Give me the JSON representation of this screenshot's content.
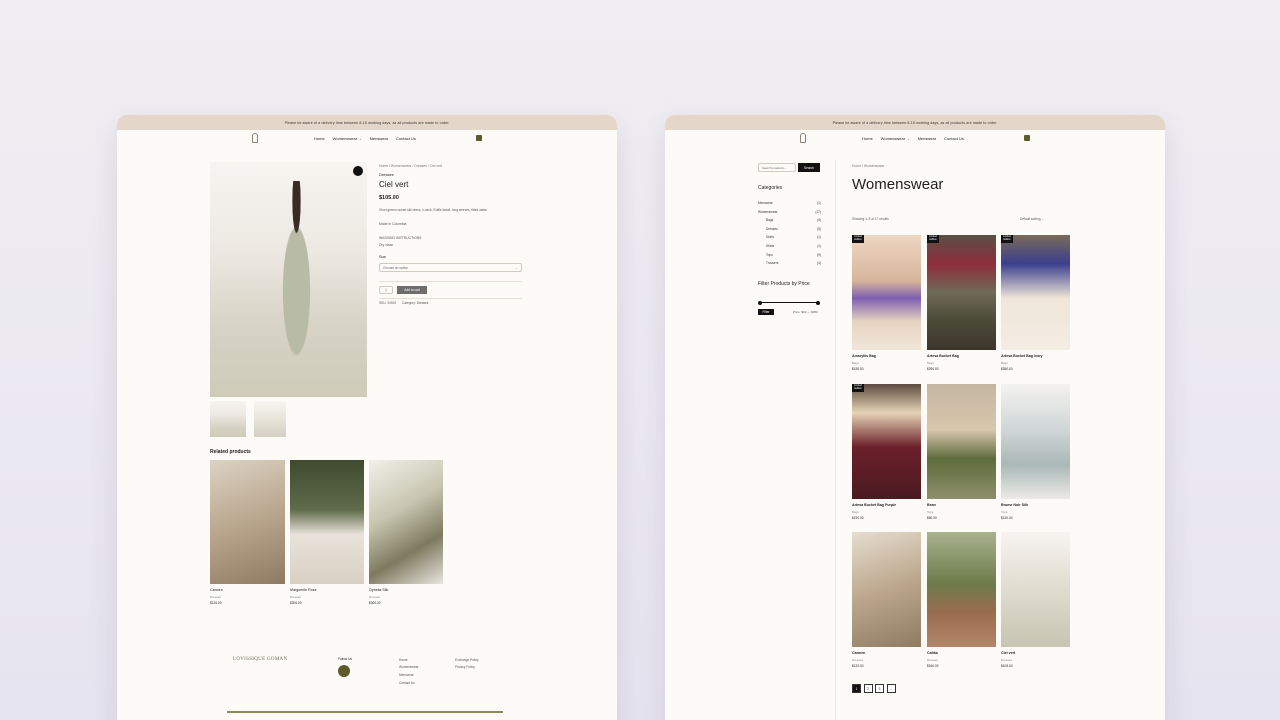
{
  "announcement": "Please be aware of a delivery time between 8-15 working days, as all products are made to order.",
  "nav": {
    "home": "Home",
    "womenswear": "Womenswear",
    "menswear": "Menswear",
    "contact": "Contact Us",
    "chevron": "⌄"
  },
  "product": {
    "breadcrumb": "Home / Womenswear / Dresses / Ciel vert",
    "category": "Dresses",
    "title": "Ciel vert",
    "price": "$105.00",
    "description": "Short green ruched silk dress, v-neck, Ruffle detail, long sleeves, fitted waist.",
    "made_in": "Made in Colombia",
    "washing_title": "WASHING INSTRUCTIONS",
    "washing_text": "Dry clean",
    "size_label": "Size",
    "size_placeholder": "Choose an option",
    "qty": "1",
    "add_to_cart": "Add to cart",
    "sku": "SKU: 20022",
    "category_meta": "Category: Dresses",
    "related_title": "Related products",
    "related": [
      {
        "name": "Carmen",
        "cat": "Dresses",
        "price": "$120.00"
      },
      {
        "name": "Marguerite Rose",
        "cat": "Dresses",
        "price": "$300.00"
      },
      {
        "name": "Ophelia Silk",
        "cat": "Dresses",
        "price": "$300.00"
      }
    ],
    "footer": {
      "brand": "LOVISSIQUE GOMAN",
      "follow": "Follow Us",
      "links": [
        "Home",
        "Womenswear",
        "Menswear",
        "Contact Us"
      ],
      "policies": [
        "Exchange Policy",
        "Privacy Policy"
      ]
    }
  },
  "shop": {
    "search_placeholder": "Search products...",
    "search_button": "Search",
    "categories_title": "Categories",
    "categories": [
      {
        "name": "Menswear",
        "count": "(1)",
        "sub": false
      },
      {
        "name": "Womenswear",
        "count": "(17)",
        "sub": false
      },
      {
        "name": "Bags",
        "count": "(4)",
        "sub": true
      },
      {
        "name": "Dresses",
        "count": "(5)",
        "sub": true
      },
      {
        "name": "Skirts",
        "count": "(1)",
        "sub": true
      },
      {
        "name": "Shirts",
        "count": "(1)",
        "sub": true
      },
      {
        "name": "Tops",
        "count": "(9)",
        "sub": true
      },
      {
        "name": "Trousers",
        "count": "(4)",
        "sub": true
      }
    ],
    "filter_title": "Filter Products by Price",
    "filter_button": "Filter",
    "price_range": "Price: $60 — $350",
    "breadcrumb": "Home / Womenswear",
    "title": "Womenswear",
    "results": "Showing 1–9 of 17 results",
    "sorting": "Default sorting",
    "badge": "Limited Edition",
    "products": [
      {
        "name": "Amaryllis Bag",
        "cat": "Bags",
        "price": "$150.00"
      },
      {
        "name": "Artesa Bucket Bag",
        "cat": "Bags",
        "price": "$290.00"
      },
      {
        "name": "Artesa Bucket Bag Ivory",
        "cat": "Bags",
        "price": "$350.00"
      },
      {
        "name": "Artesa Bucket Bag Purple",
        "cat": "Bags",
        "price": "$190.00"
      },
      {
        "name": "Bean",
        "cat": "Tops",
        "price": "$60.00"
      },
      {
        "name": "Brume Noir Silk",
        "cat": "Tops",
        "price": "$130.00"
      },
      {
        "name": "Carmen",
        "cat": "Dresses",
        "price": "$120.00"
      },
      {
        "name": "Caliba",
        "cat": "Dresses",
        "price": "$160.00"
      },
      {
        "name": "Ciel vert",
        "cat": "Dresses",
        "price": "$105.00"
      }
    ],
    "pages": [
      "1",
      "2",
      "3",
      "→"
    ]
  }
}
